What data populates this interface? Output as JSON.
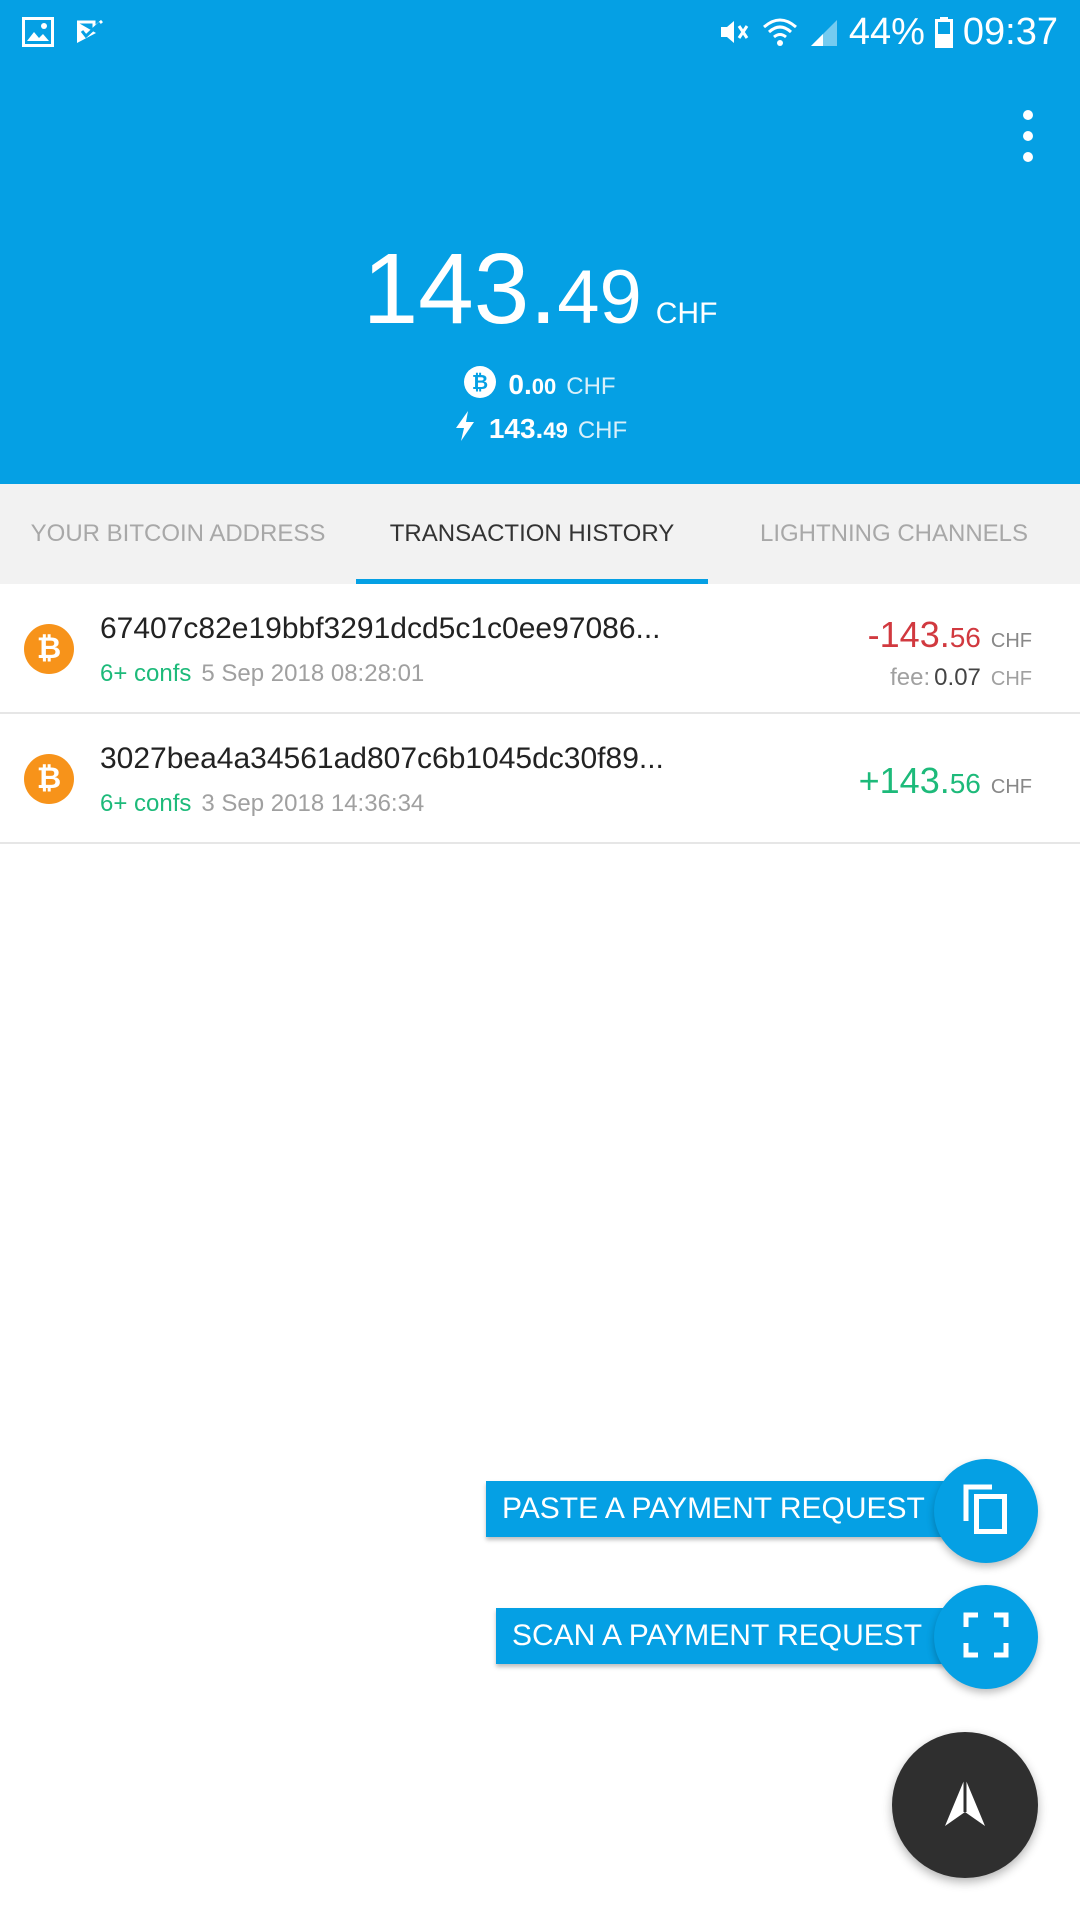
{
  "status_bar": {
    "battery": "44%",
    "time": "09:37",
    "icons": [
      "gallery-icon",
      "check-icon",
      "mute-icon",
      "wifi-icon",
      "signal-icon",
      "battery-icon"
    ]
  },
  "header": {
    "balance_int": "143",
    "balance_sep": ".",
    "balance_dec": "49",
    "balance_currency": "CHF",
    "onchain": {
      "int": "0.",
      "dec": "00",
      "currency": "CHF",
      "icon": "bitcoin-icon"
    },
    "lightning": {
      "int": "143.",
      "dec": "49",
      "currency": "CHF",
      "icon": "lightning-icon"
    },
    "menu_icon": "more-vert-icon"
  },
  "tabs": [
    {
      "label": "YOUR BITCOIN ADDRESS",
      "active": false
    },
    {
      "label": "TRANSACTION HISTORY",
      "active": true
    },
    {
      "label": "LIGHTNING CHANNELS",
      "active": false
    }
  ],
  "transactions": [
    {
      "id": "67407c82e19bbf3291dcd5c1c0ee97086...",
      "confs": "6+ confs",
      "date": "5 Sep 2018 08:28:01",
      "amount_int": "-143.",
      "amount_dec": "56",
      "currency": "CHF",
      "fee_label": "fee:",
      "fee_value": "0.07",
      "fee_currency": "CHF"
    },
    {
      "id": "3027bea4a34561ad807c6b1045dc30f89...",
      "confs": "6+ confs",
      "date": "3 Sep 2018 14:36:34",
      "amount_int": "+143.",
      "amount_dec": "56",
      "currency": "CHF"
    }
  ],
  "actions": {
    "paste_label": "PASTE A PAYMENT REQUEST",
    "scan_label": "SCAN A PAYMENT REQUEST",
    "paste_icon": "copy-icon",
    "scan_icon": "scan-frame-icon",
    "main_icon": "send-arrow-icon"
  },
  "colors": {
    "primary": "#05A0E4",
    "negative": "#D1393F",
    "positive": "#1DBA7A",
    "bitcoin": "#F7931A",
    "fab_dark": "#2F2F2F"
  }
}
